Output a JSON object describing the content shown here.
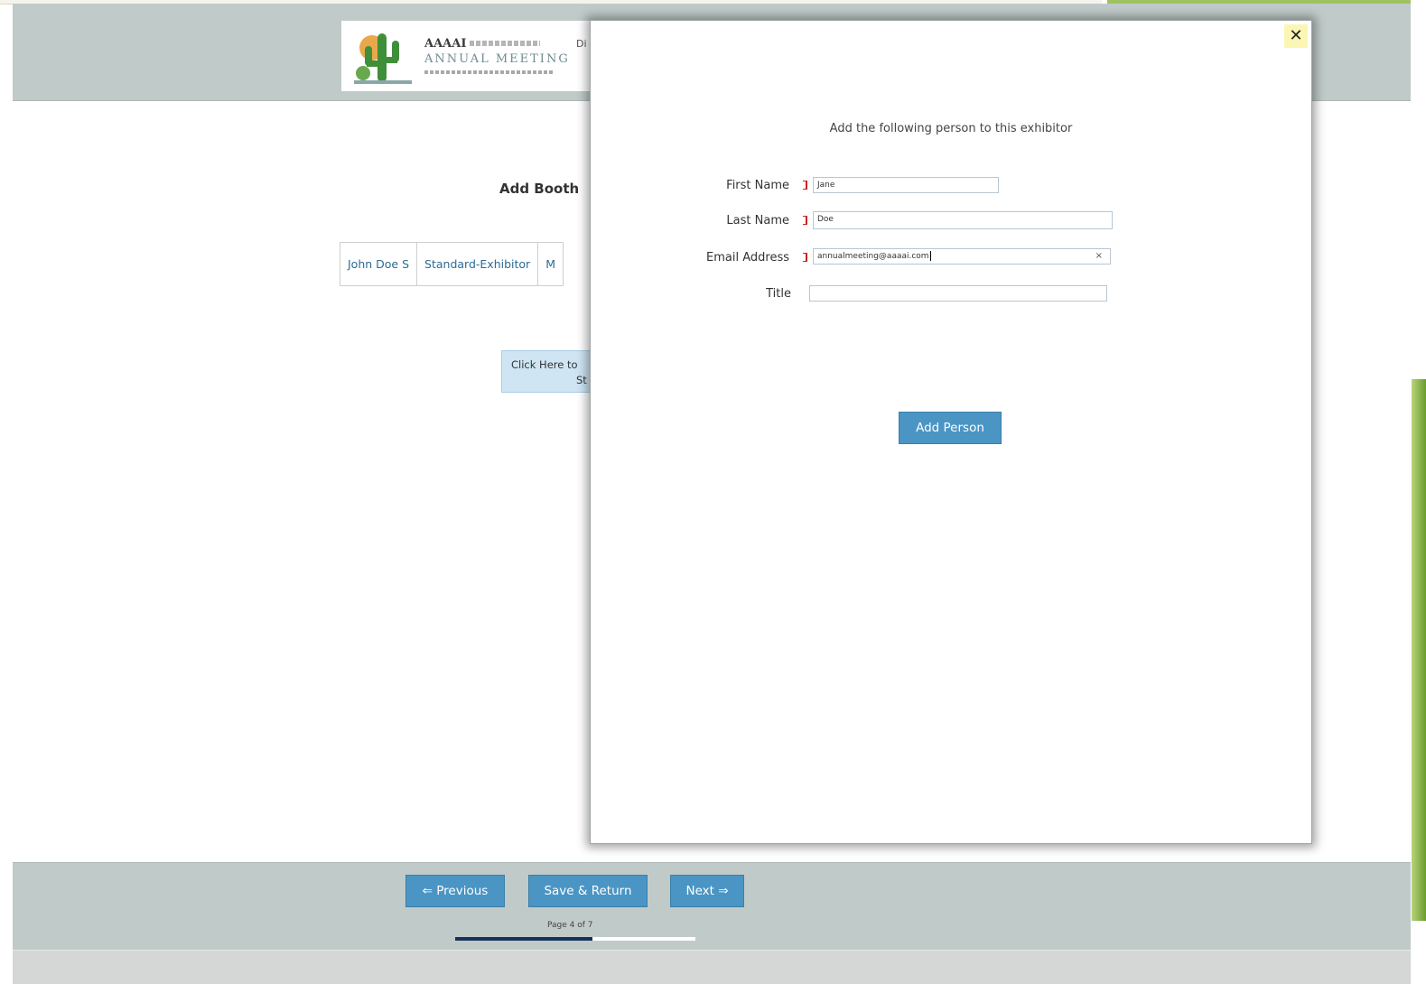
{
  "header": {
    "logo": {
      "brand": "AAAAI",
      "title": "ANNUAL MEETING"
    },
    "partial_text": "Di"
  },
  "background_page": {
    "title": "Add Booth",
    "staff_row": [
      "John Doe S",
      "Standard-Exhibitor",
      "M"
    ],
    "click_here_line1": "Click Here to",
    "click_here_line2": "St"
  },
  "modal": {
    "close_label": "✕",
    "heading": "Add the following person to this exhibitor",
    "fields": {
      "first_name": {
        "label": "First Name",
        "value": "Jane",
        "required": true
      },
      "last_name": {
        "label": "Last Name",
        "value": "Doe",
        "required": true
      },
      "email": {
        "label": "Email Address",
        "value": "annualmeeting@aaaai.com",
        "required": true,
        "clear_label": "×"
      },
      "title": {
        "label": "Title",
        "value": "",
        "required": false
      }
    },
    "submit_label": "Add Person"
  },
  "footer": {
    "previous_label": "⇐ Previous",
    "save_label": "Save & Return",
    "next_label": "Next ⇒",
    "page_label": "Page 4 of 7",
    "progress": {
      "current": 4,
      "total": 7
    }
  },
  "colors": {
    "header_bg": "#c0cac9",
    "button_blue": "#4a95c4",
    "link_blue": "#2c6b95",
    "progress_navy": "#16325c",
    "close_bg": "#fbf6b4",
    "required_red": "#cc2222"
  }
}
